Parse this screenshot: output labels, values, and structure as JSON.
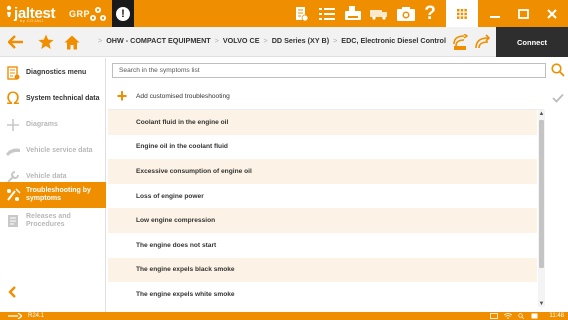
{
  "app": {
    "logo_main": "jaltest",
    "logo_sub": "by COJALI",
    "product": "GRP"
  },
  "header": {
    "connect_label": "Connect"
  },
  "breadcrumb": {
    "items": [
      "OHW - COMPACT EQUIPMENT",
      "VOLVO CE",
      "DD Series (XY B)",
      "EDC, Electronic Diesel Control"
    ],
    "separator": ">"
  },
  "sidebar": {
    "items": [
      {
        "label": "Diagnostics menu",
        "icon": "diagnostics-icon",
        "state": "normal"
      },
      {
        "label": "System technical data",
        "icon": "ohm-icon",
        "state": "normal"
      },
      {
        "label": "Diagrams",
        "icon": "diagram-icon",
        "state": "disabled"
      },
      {
        "label": "Vehicle service data",
        "icon": "service-icon",
        "state": "disabled"
      },
      {
        "label": "Vehicle data",
        "icon": "wrench-icon",
        "state": "disabled"
      },
      {
        "label": "Troubleshooting by symptoms",
        "icon": "troubleshooting-icon",
        "state": "active"
      },
      {
        "label": "Releases and Procedures",
        "icon": "document-icon",
        "state": "disabled"
      }
    ]
  },
  "search": {
    "placeholder": "Search in the symptoms list",
    "value": ""
  },
  "add_action": {
    "label": "Add customised troubleshooting"
  },
  "symptoms": [
    "Coolant fluid in the engine oil",
    "Engine oil in the coolant fluid",
    "Excessive consumption of engine oil",
    "Loss of engine power",
    "Low engine compression",
    "The engine does not start",
    "The engine expels black smoke",
    "The engine expels white smoke"
  ],
  "status": {
    "version": "R24.1",
    "time": "11:48"
  },
  "colors": {
    "accent": "#ef8f00",
    "alt_row": "#fcf3e6",
    "dark": "#2e2e2e"
  }
}
